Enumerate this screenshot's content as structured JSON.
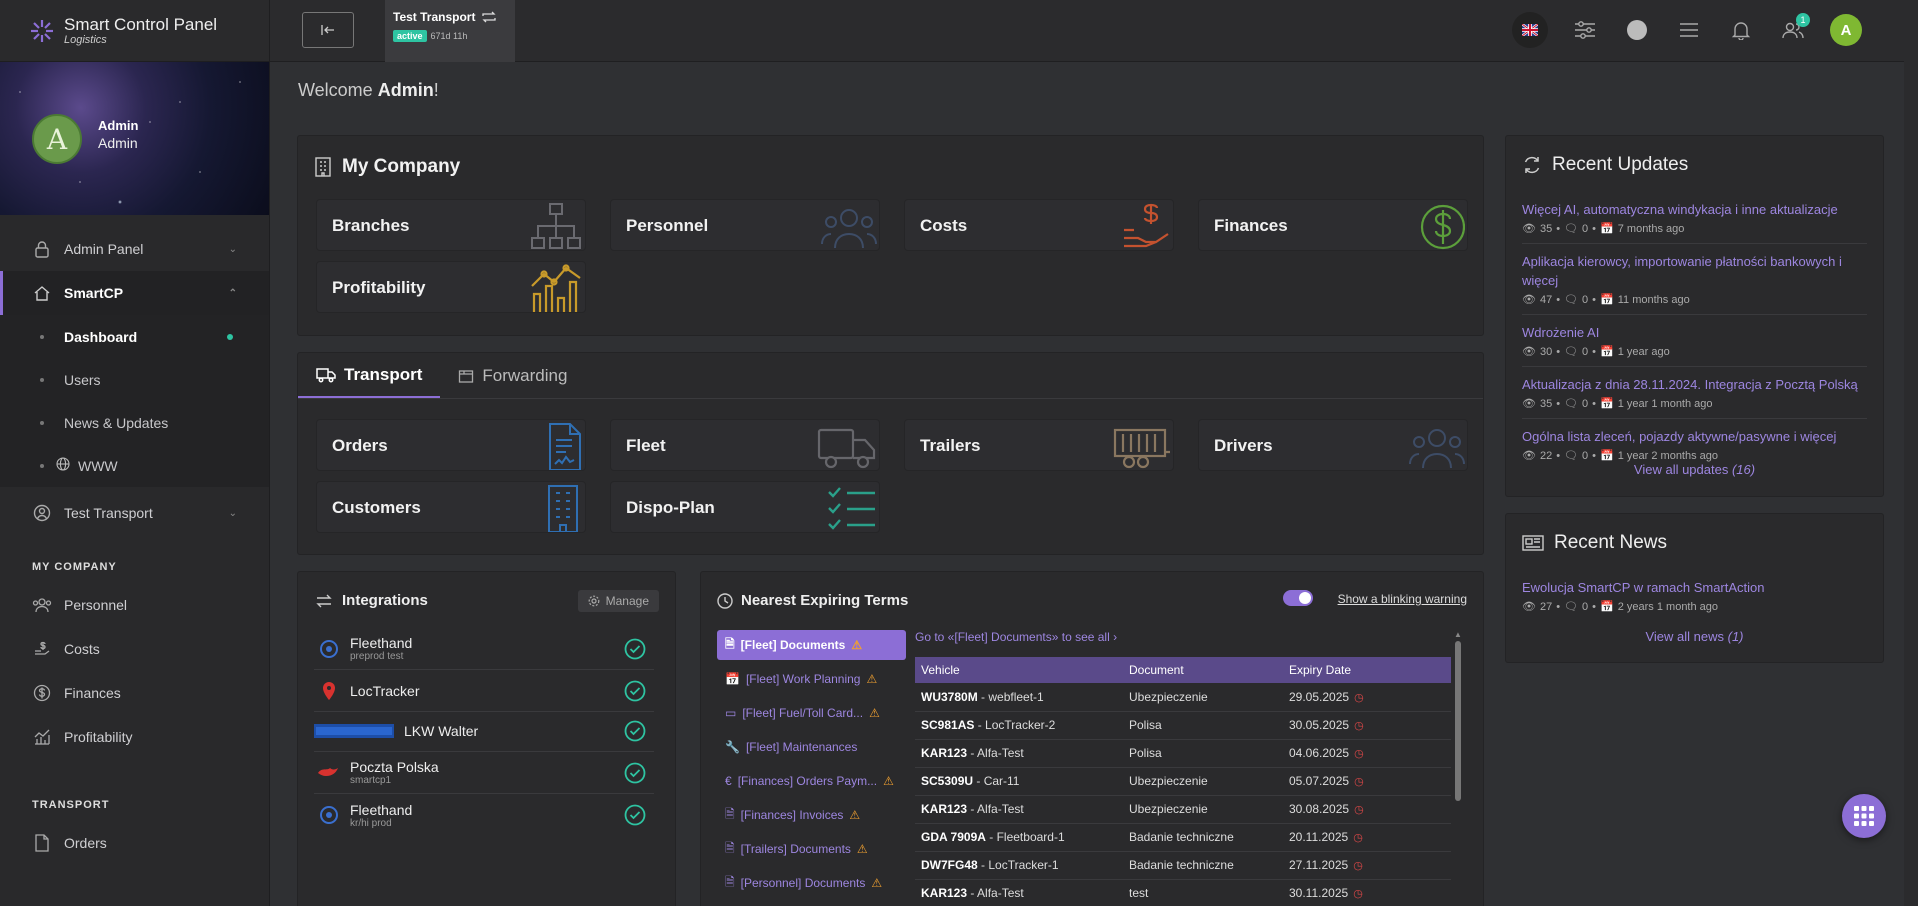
{
  "brand": {
    "title": "Smart Control Panel",
    "subtitle": "Logistics"
  },
  "user": {
    "avatar_letter": "A",
    "name": "Admin",
    "role": "Admin"
  },
  "sidebar": {
    "items": [
      {
        "label": "Admin Panel"
      },
      {
        "label": "SmartCP"
      }
    ],
    "sub_items": [
      {
        "label": "Dashboard"
      },
      {
        "label": "Users"
      },
      {
        "label": "News & Updates"
      },
      {
        "label": "WWW"
      }
    ],
    "test_transport": {
      "label": "Test Transport"
    },
    "section_company": "MY COMPANY",
    "company_items": [
      {
        "label": "Personnel"
      },
      {
        "label": "Costs"
      },
      {
        "label": "Finances"
      },
      {
        "label": "Profitability"
      }
    ],
    "section_transport": "TRANSPORT",
    "transport_items": [
      {
        "label": "Orders"
      }
    ]
  },
  "topbar": {
    "tab_title": "Test Transport",
    "status": "active",
    "uptime": "671d 11h",
    "notif_count": "1",
    "avatar": "A"
  },
  "welcome": {
    "prefix": "Welcome ",
    "name": "Admin",
    "suffix": "!"
  },
  "company": {
    "title": "My Company",
    "tiles": [
      "Branches",
      "Personnel",
      "Costs",
      "Finances",
      "Profitability"
    ]
  },
  "transport": {
    "tabs": [
      "Transport",
      "Forwarding"
    ],
    "tiles": [
      "Orders",
      "Fleet",
      "Trailers",
      "Drivers",
      "Customers",
      "Dispo-Plan"
    ]
  },
  "integrations": {
    "title": "Integrations",
    "manage": "Manage",
    "rows": [
      {
        "name": "Fleethand",
        "sub": "preprod test"
      },
      {
        "name": "LocTracker",
        "sub": ""
      },
      {
        "name": "LKW Walter",
        "sub": ""
      },
      {
        "name": "Poczta Polska",
        "sub": "smartcp1"
      },
      {
        "name": "Fleethand",
        "sub": "kr/hi prod"
      }
    ]
  },
  "terms": {
    "title": "Nearest Expiring Terms",
    "blink_label": "Show a blinking warning",
    "goto": "Go to «[Fleet] Documents» to see all",
    "buttons": [
      "[Fleet] Documents",
      "[Fleet] Work Planning",
      "[Fleet] Fuel/Toll Card...",
      "[Fleet] Maintenances",
      "[Finances] Orders Paym...",
      "[Finances] Invoices",
      "[Trailers] Documents",
      "[Personnel] Documents"
    ],
    "columns": [
      "Vehicle",
      "Document",
      "Expiry Date"
    ],
    "rows": [
      {
        "plate": "WU3780M",
        "vehicle": " - webfleet-1",
        "doc": "Ubezpieczenie",
        "date": "29.05.2025"
      },
      {
        "plate": "SC981AS",
        "vehicle": " - LocTracker-2",
        "doc": "Polisa",
        "date": "30.05.2025"
      },
      {
        "plate": "KAR123",
        "vehicle": " - Alfa-Test",
        "doc": "Polisa",
        "date": "04.06.2025"
      },
      {
        "plate": "SC5309U",
        "vehicle": " - Car-11",
        "doc": "Ubezpieczenie",
        "date": "05.07.2025"
      },
      {
        "plate": "KAR123",
        "vehicle": " - Alfa-Test",
        "doc": "Ubezpieczenie",
        "date": "30.08.2025"
      },
      {
        "plate": "GDA 7909A",
        "vehicle": " - Fleetboard-1",
        "doc": "Badanie techniczne",
        "date": "20.11.2025"
      },
      {
        "plate": "DW7FG48",
        "vehicle": " - LocTracker-1",
        "doc": "Badanie techniczne",
        "date": "27.11.2025"
      },
      {
        "plate": "KAR123",
        "vehicle": " - Alfa-Test",
        "doc": "test",
        "date": "30.11.2025"
      }
    ]
  },
  "updates": {
    "title": "Recent Updates",
    "view_all": "View all updates",
    "view_all_count": "(16)",
    "items": [
      {
        "title": "Więcej AI, automatyczna windykacja i inne aktualizacje",
        "views": "35",
        "comments": "0",
        "ago": "7 months ago"
      },
      {
        "title": "Aplikacja kierowcy, importowanie płatności bankowych i więcej",
        "views": "47",
        "comments": "0",
        "ago": "11 months ago"
      },
      {
        "title": "Wdrożenie AI",
        "views": "30",
        "comments": "0",
        "ago": "1 year ago"
      },
      {
        "title": "Aktualizacja z dnia 28.11.2024. Integracja z Pocztą Polską",
        "views": "35",
        "comments": "0",
        "ago": "1 year 1 month ago"
      },
      {
        "title": "Ogólna lista zleceń, pojazdy aktywne/pasywne i więcej",
        "views": "22",
        "comments": "0",
        "ago": "1 year 2 months ago"
      }
    ]
  },
  "news": {
    "title": "Recent News",
    "view_all": "View all news",
    "view_all_count": "(1)",
    "items": [
      {
        "title": "Ewolucja SmartCP w ramach SmartAction",
        "views": "27",
        "comments": "0",
        "ago": "2 years 1 month ago"
      }
    ]
  }
}
